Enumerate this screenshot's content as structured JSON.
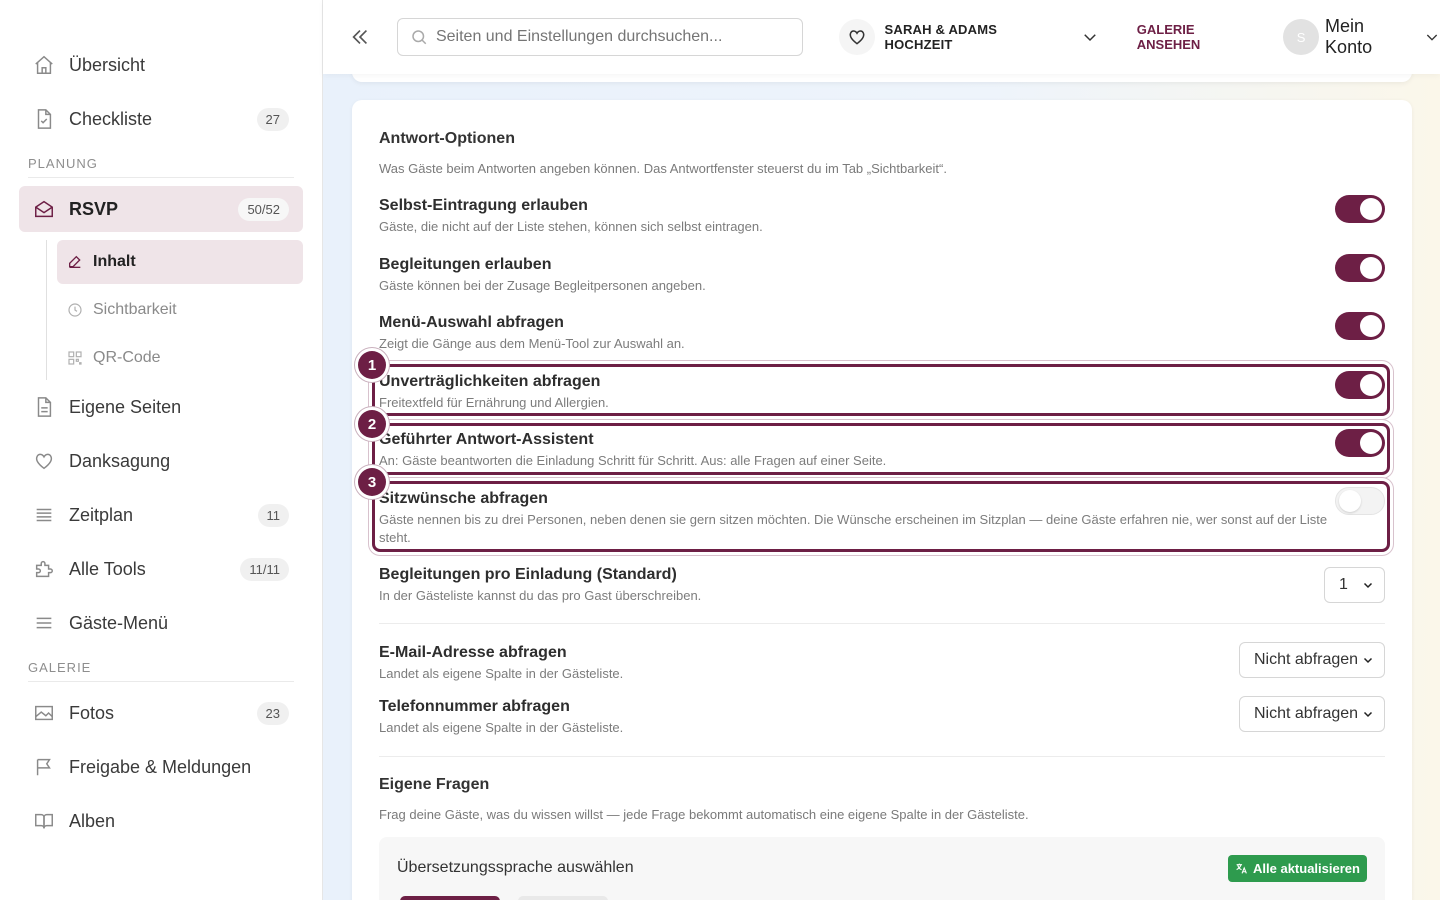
{
  "sidebar": {
    "items_top": [
      {
        "label": "Übersicht",
        "icon": "home-icon"
      },
      {
        "label": "Checkliste",
        "icon": "checklist-icon",
        "badge": "27"
      }
    ],
    "section_planung": "PLANUNG",
    "rsvp": {
      "label": "RSVP",
      "badge": "50/52",
      "icon": "envelope-open-icon"
    },
    "rsvp_sub": [
      {
        "label": "Inhalt",
        "icon": "edit-icon"
      },
      {
        "label": "Sichtbarkeit",
        "icon": "clock-icon"
      },
      {
        "label": "QR-Code",
        "icon": "qr-code-icon"
      }
    ],
    "items_mid": [
      {
        "label": "Eigene Seiten",
        "icon": "page-icon"
      },
      {
        "label": "Danksagung",
        "icon": "heart-icon"
      },
      {
        "label": "Zeitplan",
        "icon": "list-icon",
        "badge": "11"
      },
      {
        "label": "Alle Tools",
        "icon": "puzzle-icon",
        "badge": "11/11"
      },
      {
        "label": "Gäste-Menü",
        "icon": "menu-icon"
      }
    ],
    "section_galerie": "GALERIE",
    "items_galerie": [
      {
        "label": "Fotos",
        "icon": "image-icon",
        "badge": "23"
      },
      {
        "label": "Freigabe & Meldungen",
        "icon": "flag-icon"
      },
      {
        "label": "Alben",
        "icon": "book-icon"
      }
    ]
  },
  "header": {
    "search_placeholder": "Seiten und Einstellungen durchsuchen...",
    "event_name": "SARAH & ADAMS HOCHZEIT",
    "gallery_link": "GALERIE ANSEHEN",
    "avatar_initial": "S",
    "account_label": "Mein Konto"
  },
  "main": {
    "section_title": "Antwort-Optionen",
    "section_desc": "Was Gäste beim Antworten angeben können. Das Antwortfenster steuerst du im Tab „Sichtbarkeit“.",
    "options": [
      {
        "title": "Selbst-Eintragung erlauben",
        "desc": "Gäste, die nicht auf der Liste stehen, können sich selbst eintragen.",
        "enabled": true
      },
      {
        "title": "Begleitungen erlauben",
        "desc": "Gäste können bei der Zusage Begleitpersonen angeben.",
        "enabled": true
      },
      {
        "title": "Menü-Auswahl abfragen",
        "desc": "Zeigt die Gänge aus dem Menü-Tool zur Auswahl an.",
        "enabled": true
      },
      {
        "title": "Unverträglichkeiten abfragen",
        "desc": "Freitextfeld für Ernährung und Allergien.",
        "enabled": true,
        "step": "1"
      },
      {
        "title": "Geführter Antwort-Assistent",
        "desc": "An: Gäste beantworten die Einladung Schritt für Schritt. Aus: alle Fragen auf einer Seite.",
        "enabled": true,
        "step": "2"
      },
      {
        "title": "Sitzwünsche abfragen",
        "desc": "Gäste nennen bis zu drei Personen, neben denen sie gern sitzen möchten. Die Wünsche erscheinen im Sitzplan — deine Gäste erfahren nie, wer sonst auf der Liste steht.",
        "enabled": false,
        "step": "3"
      }
    ],
    "companions": {
      "title": "Begleitungen pro Einladung (Standard)",
      "desc": "In der Gästeliste kannst du das pro Gast überschreiben.",
      "value": "1"
    },
    "email": {
      "title": "E-Mail-Adresse abfragen",
      "desc": "Landet als eigene Spalte in der Gästeliste.",
      "value": "Nicht abfragen"
    },
    "phone": {
      "title": "Telefonnummer abfragen",
      "desc": "Landet als eigene Spalte in der Gästeliste.",
      "value": "Nicht abfragen"
    },
    "custom_title": "Eigene Fragen",
    "custom_desc": "Frag deine Gäste, was du wissen willst — jede Frage bekommt automatisch eine eigene Spalte in der Gästeliste.",
    "translation_title": "Übersetzungssprache auswählen",
    "update_all": "Alle aktualisieren"
  },
  "colors": {
    "accent": "#6d1f45",
    "green": "#2e9b4e"
  }
}
